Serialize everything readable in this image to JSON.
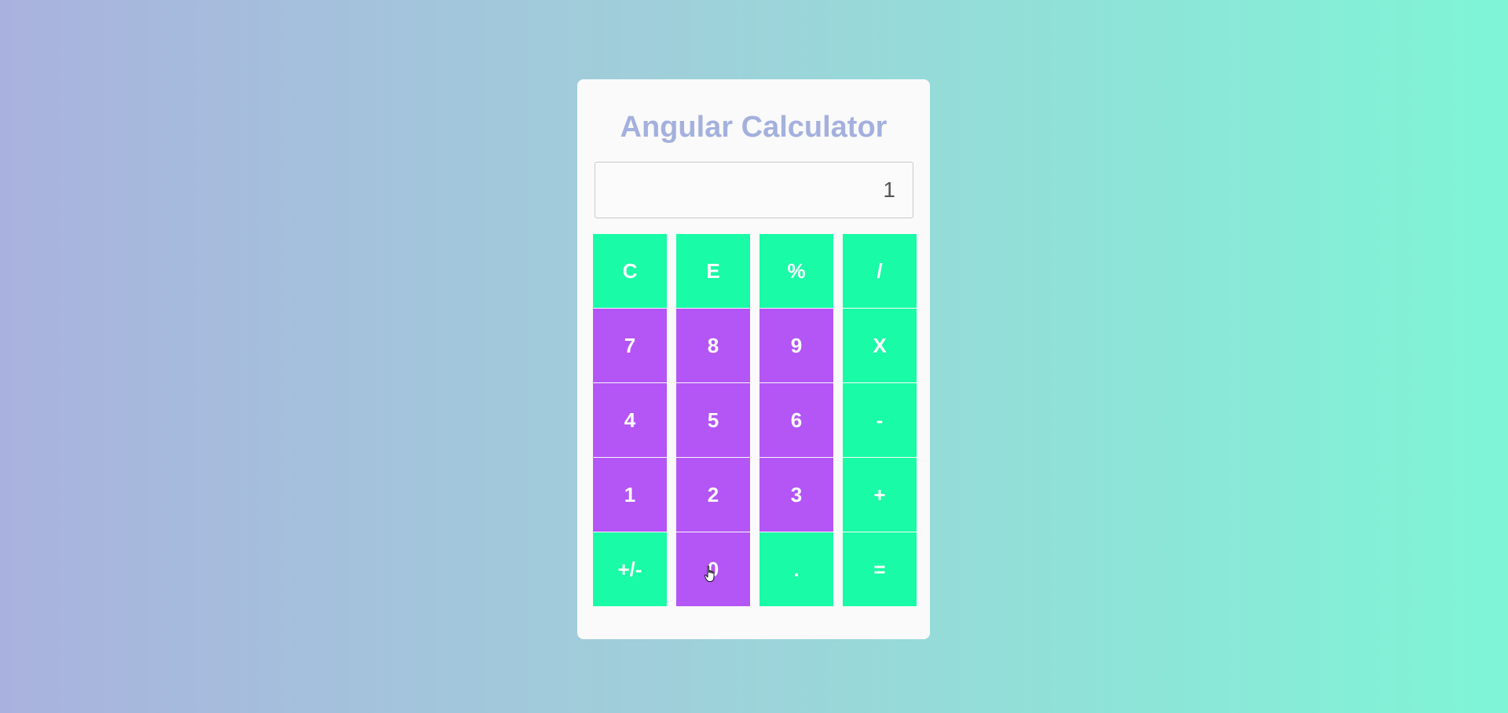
{
  "calculator": {
    "title": "Angular Calculator",
    "display_value": "1",
    "colors": {
      "operator_key": "#19fba6",
      "number_key": "#b455f6",
      "title": "#a4b0dd"
    },
    "keys": [
      {
        "label": "C",
        "kind": "op"
      },
      {
        "label": "E",
        "kind": "op"
      },
      {
        "label": "%",
        "kind": "op"
      },
      {
        "label": "/",
        "kind": "op"
      },
      {
        "label": "7",
        "kind": "num"
      },
      {
        "label": "8",
        "kind": "num"
      },
      {
        "label": "9",
        "kind": "num"
      },
      {
        "label": "X",
        "kind": "op"
      },
      {
        "label": "4",
        "kind": "num"
      },
      {
        "label": "5",
        "kind": "num"
      },
      {
        "label": "6",
        "kind": "num"
      },
      {
        "label": "-",
        "kind": "op"
      },
      {
        "label": "1",
        "kind": "num"
      },
      {
        "label": "2",
        "kind": "num"
      },
      {
        "label": "3",
        "kind": "num"
      },
      {
        "label": "+",
        "kind": "op"
      },
      {
        "label": "+/-",
        "kind": "op"
      },
      {
        "label": "0",
        "kind": "num"
      },
      {
        "label": ".",
        "kind": "op"
      },
      {
        "label": "=",
        "kind": "op"
      }
    ]
  }
}
